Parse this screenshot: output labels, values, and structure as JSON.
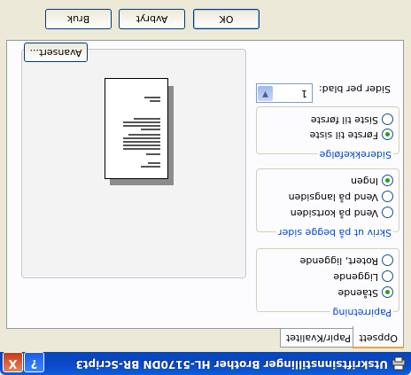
{
  "window": {
    "title": "Utskriftsinnstillinger Brother HL-5170DN BR-Script3",
    "help_symbol": "?",
    "close_symbol": "X"
  },
  "tabs": [
    {
      "label": "Oppsett",
      "active": true
    },
    {
      "label": "Papir/Kvalitet",
      "active": false
    }
  ],
  "orientation": {
    "label": "Papirretning",
    "options": [
      {
        "label": "Stående",
        "selected": true
      },
      {
        "label": "Liggende",
        "selected": false
      },
      {
        "label": "Rotert, liggende",
        "selected": false
      }
    ]
  },
  "duplex": {
    "label": "Skriv ut på begge sider",
    "options": [
      {
        "label": "Vend på kortsiden",
        "selected": false
      },
      {
        "label": "Vend på langsiden",
        "selected": false
      },
      {
        "label": "Ingen",
        "selected": true
      }
    ]
  },
  "page_order": {
    "label": "Siderekkefølge",
    "options": [
      {
        "label": "Første til siste",
        "selected": true
      },
      {
        "label": "Siste til første",
        "selected": false
      }
    ]
  },
  "pages_per_sheet": {
    "label": "Sider per blad:",
    "value": "1"
  },
  "buttons": {
    "advanced": "Avansert...",
    "ok": "OK",
    "cancel": "Avbryt",
    "apply": "Bruk"
  },
  "colors": {
    "titlebar": "#0b49c9",
    "group_label": "#0046d5",
    "radio_selected": "#21a121",
    "tab_active_accent": "#f1a13e"
  }
}
